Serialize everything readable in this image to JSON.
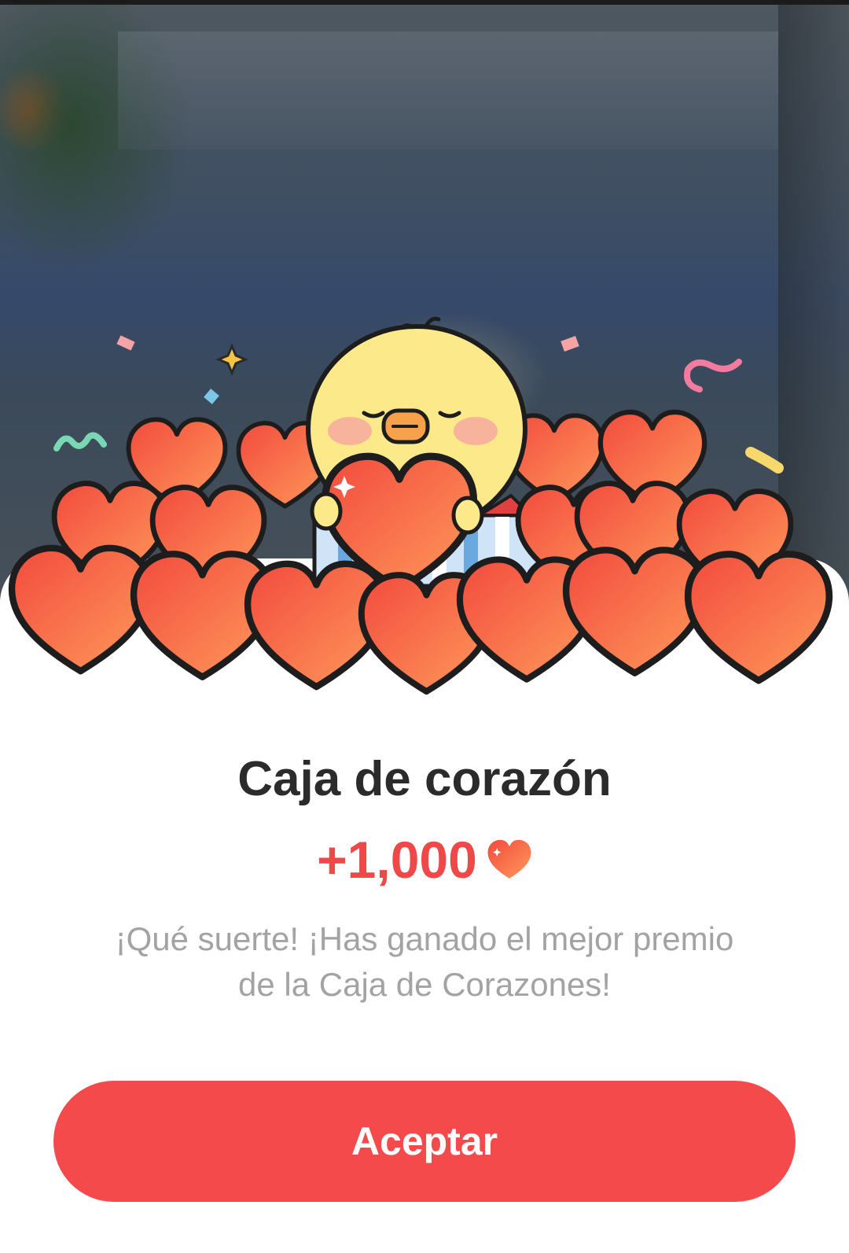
{
  "popup": {
    "title": "Caja de corazón",
    "reward_amount": "+1,000",
    "reward_icon": "heart-icon",
    "message_line1": "¡Qué suerte! ¡Has ganado el mejor premio",
    "message_line2": "de la Caja de Corazones!",
    "accept_label": "Aceptar"
  },
  "colors": {
    "accent": "#f44a4c",
    "amount_text": "#ee4848",
    "title_text": "#2b2b2b",
    "message_text": "#a3a3a3",
    "heart_light": "#ff9a5a",
    "heart_dark": "#f24a3e",
    "chick": "#fbe98a"
  }
}
